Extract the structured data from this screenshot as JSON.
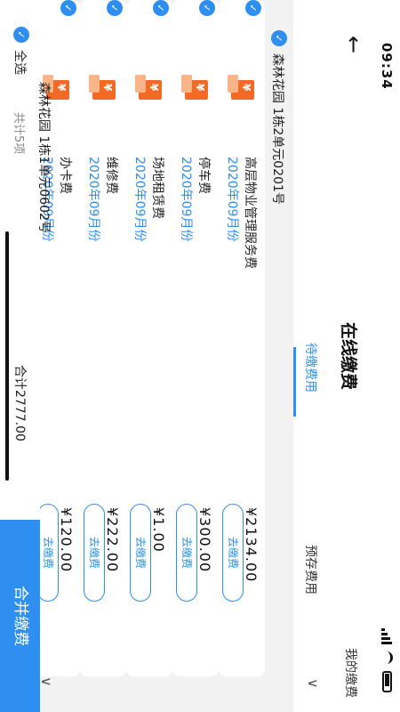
{
  "status": {
    "time": "09:34"
  },
  "header": {
    "back": "←",
    "title": "在线缴费",
    "right_link": "我的缴费"
  },
  "tabs": [
    {
      "label": "待缴费用",
      "active": true
    },
    {
      "label": "预存费用",
      "active": false
    }
  ],
  "tab_chevron": "∨",
  "group": {
    "address": "森林花园 1栋2单元0201号",
    "checked": true
  },
  "items": [
    {
      "name": "高层物业管理服务费",
      "month": "2020年09月份",
      "amount": "¥2134.00",
      "action": "去缴费",
      "checked": true
    },
    {
      "name": "停车费",
      "month": "2020年09月份",
      "amount": "¥300.00",
      "action": "去缴费",
      "checked": true
    },
    {
      "name": "场地租赁费",
      "month": "2020年09月份",
      "amount": "¥1.00",
      "action": "去缴费",
      "checked": true
    },
    {
      "name": "维修费",
      "month": "2020年09月份",
      "amount": "¥222.00",
      "action": "去缴费",
      "checked": true
    },
    {
      "name": "办卡费",
      "month": "2020年09月份",
      "amount": "¥120.00",
      "action": "去缴费",
      "checked": true
    }
  ],
  "group2": {
    "address": "森林花园 1栋1单元0602号",
    "chevron": "∨"
  },
  "bottom": {
    "select_all": "全选",
    "count": "共计5项",
    "total": "合计2777.00",
    "merge_button": "合并缴费"
  },
  "colors": {
    "accent": "#2e8ff0",
    "icon_orange": "#f26a24"
  }
}
